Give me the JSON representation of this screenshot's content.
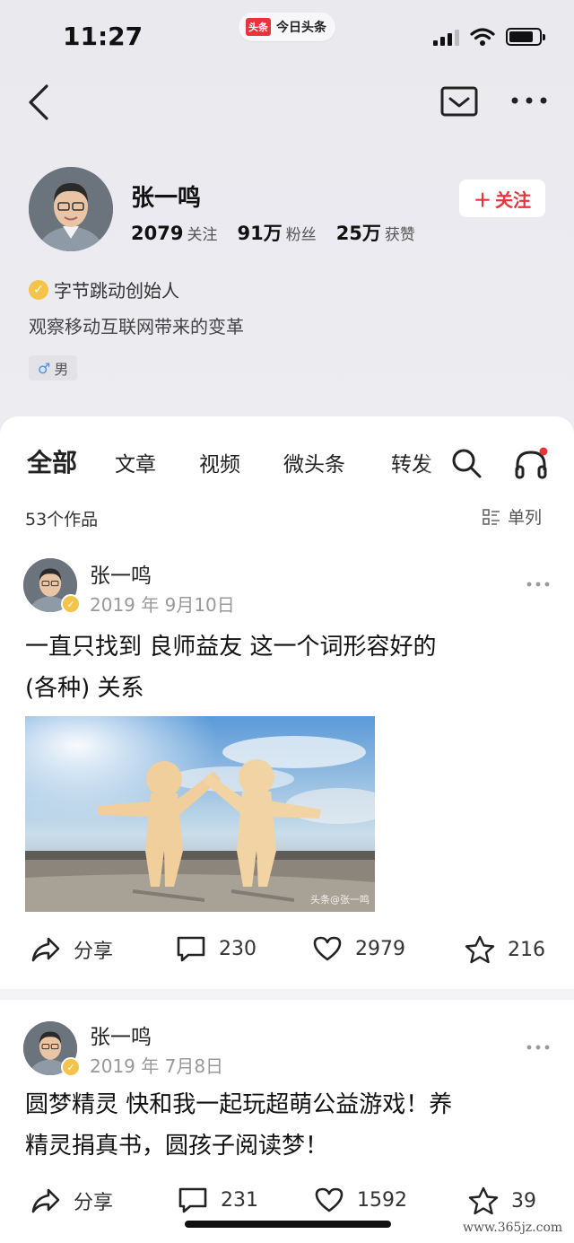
{
  "status_bar": {
    "time": "11:27",
    "app_logo": "头条",
    "app_name": "今日头条"
  },
  "nav": {
    "back_icon": "chevron-left-icon",
    "mail_icon": "envelope-icon",
    "more_icon": "more-dots-icon"
  },
  "profile": {
    "name": "张一鸣",
    "follow_label": "关注",
    "stats": [
      {
        "value": "2079",
        "label": "关注"
      },
      {
        "value": "91万",
        "label": "粉丝"
      },
      {
        "value": "25万",
        "label": "获赞"
      }
    ],
    "verification": "字节跳动创始人",
    "bio": "观察移动互联网带来的变革",
    "gender_symbol": "♂",
    "gender": "男"
  },
  "tabs": {
    "items": [
      "全部",
      "文章",
      "视频",
      "微头条",
      "转发"
    ],
    "active": "全部"
  },
  "works": {
    "count_label": "53个作品",
    "view_mode": "单列"
  },
  "posts": [
    {
      "author": "张一鸣",
      "date": "2019 年 9月10日",
      "text_line1": "一直只找到 良师益友  这一个词形容好的",
      "text_line2": "(各种) 关系",
      "image_watermark": "头条@张一鸣",
      "share_label": "分享",
      "comments": "230",
      "likes": "2979",
      "favorites": "216"
    },
    {
      "author": "张一鸣",
      "date": "2019 年 7月8日",
      "text_line1": "圆梦精灵 快和我一起玩超萌公益游戏！养",
      "text_line2": "精灵捐真书，圆孩子阅读梦！",
      "share_label": "分享",
      "comments": "231",
      "likes": "1592",
      "favorites": "39"
    }
  ],
  "site_watermark": "www.365jz.com",
  "colors": {
    "accent": "#e8343a",
    "verify": "#f3c34a",
    "page_bg": "#ececf1"
  }
}
